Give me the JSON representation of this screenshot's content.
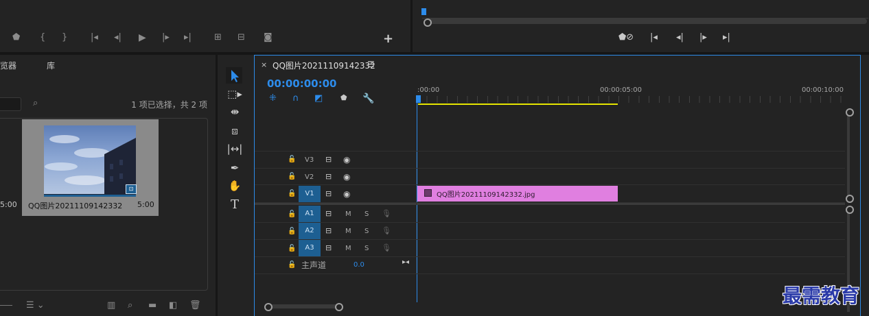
{
  "source_monitor": {
    "transport_icons": [
      "marker-icon",
      "mark-in-icon",
      "mark-out-icon",
      "go-to-in-icon",
      "step-back-icon",
      "play-icon",
      "step-forward-icon",
      "go-to-out-icon",
      "insert-icon",
      "overwrite-icon",
      "export-frame-icon"
    ],
    "add_label": "+"
  },
  "program_monitor": {
    "transport_icons": [
      "marker-link-icon",
      "go-to-in-icon",
      "step-back-icon",
      "step-forward-icon",
      "go-to-out-icon"
    ]
  },
  "project_panel": {
    "tab_browser": "览器",
    "tab_library": "库",
    "selection_status": "1 项已选择，共 2 项",
    "left_item_duration": "5:00",
    "item": {
      "name": "QQ图片20211109142332",
      "duration": "5:00"
    }
  },
  "tools": [
    "selection-tool-icon",
    "track-select-tool-icon",
    "ripple-edit-tool-icon",
    "razor-tool-icon",
    "slip-tool-icon",
    "pen-tool-icon",
    "hand-tool-icon",
    "type-tool-icon"
  ],
  "type_tool_label": "T",
  "timeline": {
    "close_label": "×",
    "sequence_name": "QQ图片20211109142332",
    "menu_label": "☰",
    "timecode": "00:00:00:00",
    "ruler": [
      ":00:00",
      "00:00:05:00",
      "00:00:10:00"
    ],
    "video_tracks": [
      {
        "label": "V3",
        "targeted": false
      },
      {
        "label": "V2",
        "targeted": false
      },
      {
        "label": "V1",
        "targeted": true
      }
    ],
    "audio_tracks": [
      {
        "label": "A1",
        "m": "M",
        "s": "S"
      },
      {
        "label": "A2",
        "m": "M",
        "s": "S"
      },
      {
        "label": "A3",
        "m": "M",
        "s": "S"
      }
    ],
    "master": {
      "label": "主声道",
      "value": "0.0"
    },
    "clip": {
      "name": "QQ图片20211109142332.jpg",
      "color": "#e07fe0"
    }
  },
  "watermark": "最需教育",
  "colors": {
    "accent": "#2d8ceb",
    "clip": "#e07fe0",
    "work_area": "#e6e600",
    "track_target": "#1d5f92"
  }
}
